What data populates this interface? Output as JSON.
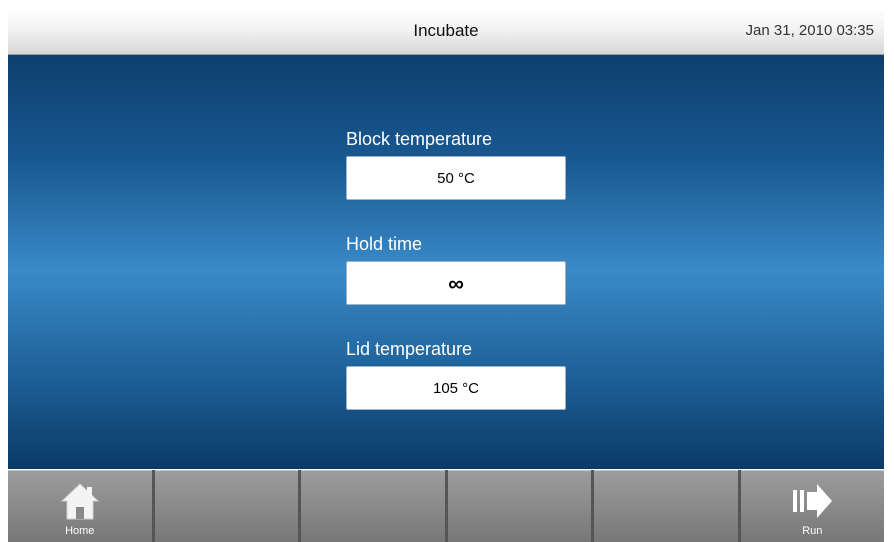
{
  "header": {
    "title": "Incubate",
    "datetime": "Jan 31, 2010 03:35"
  },
  "fields": [
    {
      "label": "Block temperature",
      "value": "50 °C"
    },
    {
      "label": "Hold time",
      "value": "∞"
    },
    {
      "label": "Lid temperature",
      "value": "105 °C"
    }
  ],
  "toolbar": {
    "home_label": "Home",
    "home_icon": "home-icon",
    "run_label": "Run",
    "run_icon": "run-arrow-icon"
  },
  "colors": {
    "background_top": "#0d3f6e",
    "background_mid": "#3a8ac8",
    "toolbar": "#8a8a8a"
  }
}
